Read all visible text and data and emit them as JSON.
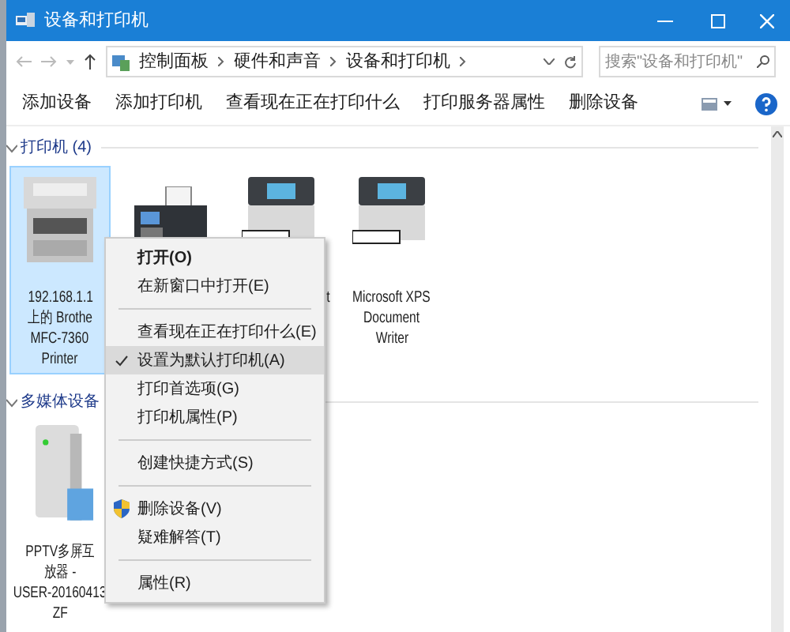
{
  "window": {
    "title": "设备和打印机"
  },
  "breadcrumb": [
    "控制面板",
    "硬件和声音",
    "设备和打印机"
  ],
  "search": {
    "placeholder": "搜索\"设备和打印机\""
  },
  "toolbar": [
    "添加设备",
    "添加打印机",
    "查看现在正在打印什么",
    "打印服务器属性",
    "删除设备"
  ],
  "groups": [
    {
      "title": "打印机 (4)",
      "expanded": true,
      "devices": [
        {
          "kind": "mfp",
          "selected": true,
          "label": [
            "192.168.1.1",
            "上的 Brothe",
            "MFC-7360",
            "Printer"
          ]
        },
        {
          "kind": "fax",
          "selected": false
        },
        {
          "kind": "printer",
          "selected": false,
          "label_right": true,
          "label": [
            "t"
          ]
        },
        {
          "kind": "printer",
          "selected": false,
          "label": [
            "Microsoft XPS",
            "Document",
            "Writer"
          ]
        }
      ]
    },
    {
      "title": "多媒体设备",
      "expanded": true,
      "devices": [
        {
          "kind": "media",
          "selected": false,
          "label": [
            "PPTV多屏互",
            "放器 -",
            "USER-20160413",
            "ZF"
          ]
        }
      ]
    }
  ],
  "context_menu": [
    {
      "kind": "item",
      "text": "打开(O)",
      "default": true,
      "checked": false,
      "shield": false,
      "selected": false
    },
    {
      "kind": "item",
      "text": "在新窗口中打开(E)",
      "default": false,
      "checked": false,
      "shield": false,
      "selected": false
    },
    {
      "kind": "separator"
    },
    {
      "kind": "item",
      "text": "查看现在正在打印什么(E)",
      "default": false,
      "checked": false,
      "shield": false,
      "selected": false
    },
    {
      "kind": "item",
      "text": "设置为默认打印机(A)",
      "default": false,
      "checked": true,
      "shield": false,
      "selected": true
    },
    {
      "kind": "item",
      "text": "打印首选项(G)",
      "default": false,
      "checked": false,
      "shield": false,
      "selected": false
    },
    {
      "kind": "item",
      "text": "打印机属性(P)",
      "default": false,
      "checked": false,
      "shield": false,
      "selected": false
    },
    {
      "kind": "separator"
    },
    {
      "kind": "item",
      "text": "创建快捷方式(S)",
      "default": false,
      "checked": false,
      "shield": false,
      "selected": false
    },
    {
      "kind": "separator"
    },
    {
      "kind": "item",
      "text": "删除设备(V)",
      "default": false,
      "checked": false,
      "shield": true,
      "selected": false
    },
    {
      "kind": "item",
      "text": "疑难解答(T)",
      "default": false,
      "checked": false,
      "shield": false,
      "selected": false
    },
    {
      "kind": "separator"
    },
    {
      "kind": "item",
      "text": "属性(R)",
      "default": false,
      "checked": false,
      "shield": false,
      "selected": false
    }
  ]
}
